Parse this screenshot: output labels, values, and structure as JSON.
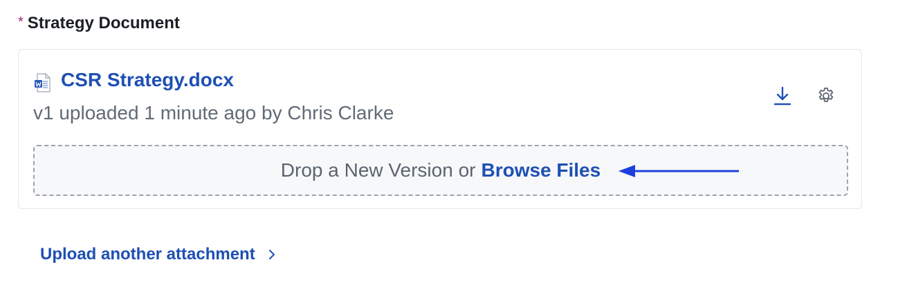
{
  "field": {
    "required_marker": "*",
    "label": "Strategy Document"
  },
  "attachment": {
    "file_icon": "word-document-icon",
    "file_name": "CSR Strategy.docx",
    "meta": "v1 uploaded 1 minute ago by Chris Clarke",
    "actions": {
      "download_icon": "download-icon",
      "settings_icon": "gear-icon"
    }
  },
  "dropzone": {
    "text": "Drop a New Version or",
    "browse_label": "Browse Files"
  },
  "annotation": {
    "arrow_color": "#1d3fe0"
  },
  "upload_another": {
    "label": "Upload another attachment",
    "icon": "chevron-right-icon"
  },
  "colors": {
    "link": "#1e4fb4",
    "required": "#a0247a",
    "meta_text": "#616a75"
  }
}
